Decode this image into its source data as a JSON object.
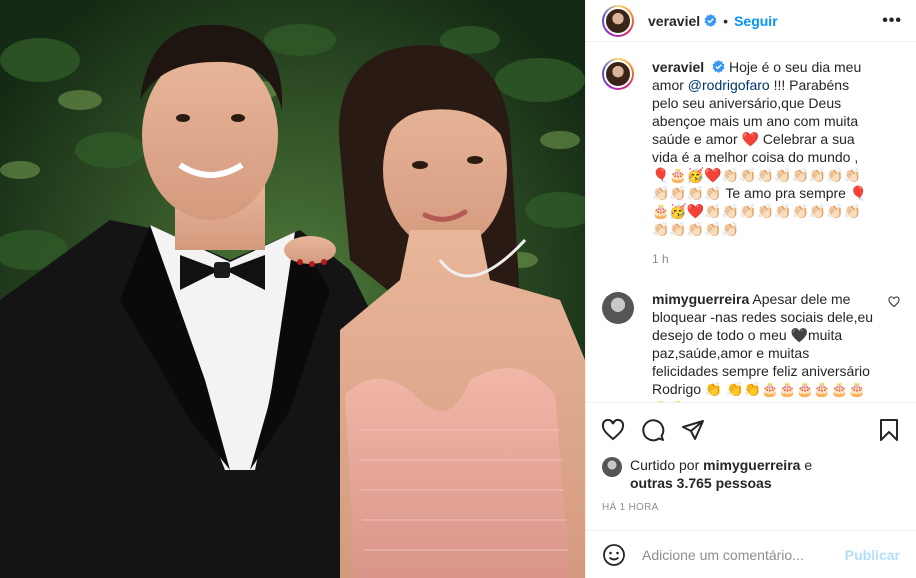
{
  "header": {
    "username": "veraviel",
    "separator": "•",
    "follow_label": "Seguir",
    "more_label": "•••"
  },
  "caption": {
    "username": "veraviel",
    "text_1": "Hoje é o seu dia meu amor",
    "mention": "@rodrigofaro",
    "text_2": " !!! Parabéns pelo seu aniversário,que Deus abençoe mais um ano com muita saúde e amor ❤️ Celebrar a sua vida é a melhor coisa do mundo , 🎈🎂🥳❤️👏🏻👏🏻👏🏻👏🏻👏🏻👏🏻👏🏻👏🏻👏🏻👏🏻👏🏻👏🏻 Te amo pra sempre 🎈🎂🥳❤️👏🏻👏🏻👏🏻👏🏻👏🏻👏🏻👏🏻👏🏻👏🏻👏🏻👏🏻👏🏻👏🏻👏🏻",
    "time": "1 h"
  },
  "comment": {
    "username": "mimyguerreira",
    "text": "Apesar dele me bloquear -nas redes sociais dele,eu desejo de todo o meu 🖤muita paz,saúde,amor e muitas felicidades sempre feliz aniversário Rodrigo 👏 👏👏🎂🎂🎂🎂🎂🎂🎂🎂"
  },
  "likes": {
    "prefix": "Curtido por",
    "user": "mimyguerreira",
    "and": "e",
    "others": "outras 3.765 pessoas"
  },
  "timestamp": "HÁ 1 HORA",
  "add_comment": {
    "placeholder": "Adicione um comentário...",
    "publish_label": "Publicar"
  },
  "colors": {
    "accent": "#0095f6",
    "publish_disabled": "#b2dffc",
    "muted": "#8e8e8e",
    "dress": "#e8a797"
  },
  "icons": [
    "verified-badge-icon",
    "more-options-icon",
    "heart-icon",
    "comment-icon",
    "share-icon",
    "bookmark-icon",
    "emoji-icon"
  ]
}
